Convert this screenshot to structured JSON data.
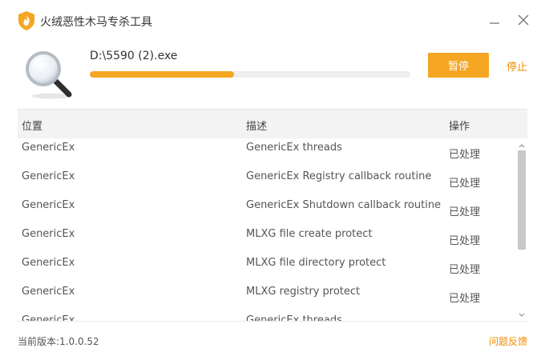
{
  "window": {
    "title": "火绒恶性木马专杀工具",
    "logo_icon": "huorong-shield-icon",
    "minimize_icon": "minimize-icon",
    "close_icon": "close-icon"
  },
  "scan": {
    "current_file": "D:\\5590 (2).exe",
    "progress": 0.45,
    "pause_label": "暂停",
    "stop_label": "停止",
    "icon": "magnifier-icon"
  },
  "table": {
    "columns": [
      "位置",
      "描述",
      "操作"
    ],
    "rows": [
      {
        "location": "GenericEx",
        "description": "GenericEx threads",
        "action": "已处理"
      },
      {
        "location": "GenericEx",
        "description": "GenericEx Registry callback routine",
        "action": "已处理"
      },
      {
        "location": "GenericEx",
        "description": "GenericEx Shutdown callback routine",
        "action": "已处理"
      },
      {
        "location": "GenericEx",
        "description": "MLXG file create protect",
        "action": "已处理"
      },
      {
        "location": "GenericEx",
        "description": "MLXG file directory protect",
        "action": "已处理"
      },
      {
        "location": "GenericEx",
        "description": "MLXG registry protect",
        "action": "已处理"
      },
      {
        "location": "GenericEx",
        "description": "GenericEx threads",
        "action": ""
      }
    ]
  },
  "footer": {
    "version": "当前版本:1.0.0.52",
    "feedback": "问题反馈"
  },
  "colors": {
    "accent": "#f5a623",
    "link": "#f08c00"
  }
}
